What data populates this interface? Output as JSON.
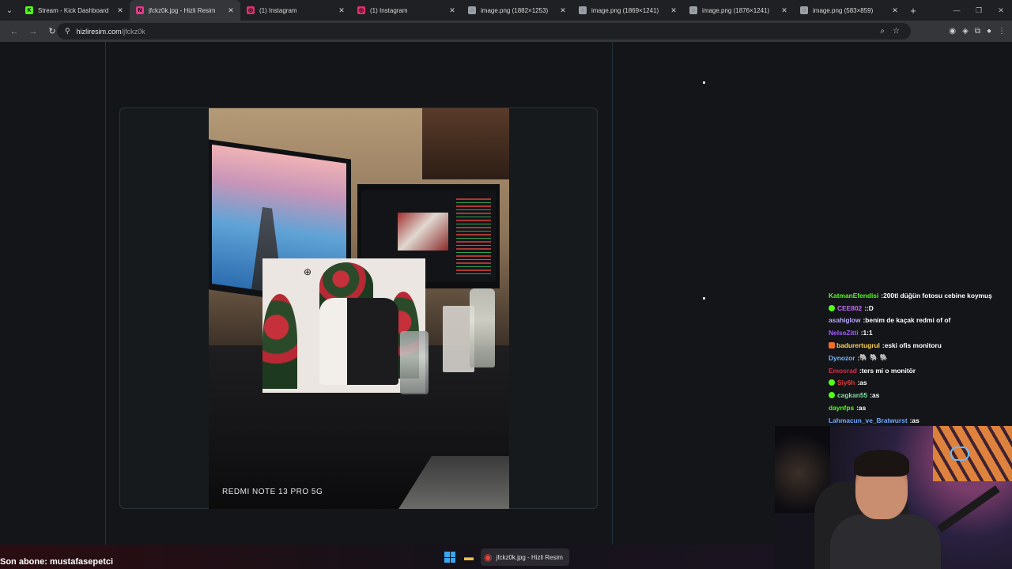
{
  "browser": {
    "tabs": [
      {
        "title": "Stream - Kick Dashboard",
        "favicon": "K",
        "favicon_color": "#53fc18",
        "active": false
      },
      {
        "title": "jfckz0k.jpg - Hizli Resim",
        "favicon": "N",
        "favicon_color": "#e23b8a",
        "active": true
      },
      {
        "title": "(1) Instagram",
        "favicon": "◎",
        "favicon_color": "#e1306c",
        "active": false
      },
      {
        "title": "(1) Instagram",
        "favicon": "◎",
        "favicon_color": "#e1306c",
        "active": false
      },
      {
        "title": "image.png (1882×1253)",
        "favicon": "◌",
        "favicon_color": "#9aa0a6",
        "active": false
      },
      {
        "title": "image.png (1869×1241)",
        "favicon": "◌",
        "favicon_color": "#9aa0a6",
        "active": false
      },
      {
        "title": "image.png (1876×1241)",
        "favicon": "◌",
        "favicon_color": "#9aa0a6",
        "active": false
      },
      {
        "title": "image.png (583×859)",
        "favicon": "◌",
        "favicon_color": "#9aa0a6",
        "active": false
      }
    ],
    "address": {
      "host": "hizliresim.com",
      "path": "/jfckz0k"
    }
  },
  "image": {
    "watermark": "REDMI NOTE 13 PRO 5G"
  },
  "chat": {
    "lines": [
      {
        "user": "KatmanEfendisi",
        "color": "#53fc18",
        "msg": "200tl düğün fotosu cebine koymuş",
        "badge": ""
      },
      {
        "user": "CEE802",
        "color": "#c36df5",
        "msg": ":D",
        "badge": "dot"
      },
      {
        "user": "asahiglow",
        "color": "#bba7ff",
        "msg": "benim de kaçak redmi of of",
        "badge": ""
      },
      {
        "user": "NelseZitti",
        "color": "#a35bff",
        "msg": "1:1",
        "badge": ""
      },
      {
        "user": "badurertugrul",
        "color": "#ffd34d",
        "msg": "eski ofis monitoru",
        "badge": "sq"
      },
      {
        "user": "Dynozor",
        "color": "#7ab8ff",
        "msg": "🐘 🐘 🐘",
        "badge": ""
      },
      {
        "user": "Emosrad",
        "color": "#d12f4b",
        "msg": "ters mi o monitör",
        "badge": ""
      },
      {
        "user": "Siy6h",
        "color": "#e03c3c",
        "msg": "as",
        "badge": "dot"
      },
      {
        "user": "cagkan55",
        "color": "#7fe0a0",
        "msg": "as",
        "badge": "dot"
      },
      {
        "user": "daynfps",
        "color": "#53fc18",
        "msg": "as",
        "badge": ""
      },
      {
        "user": "Lahmacun_ve_Bratwurst",
        "color": "#6fa8ff",
        "msg": "as",
        "badge": ""
      }
    ]
  },
  "overlay": {
    "last_sub": "Son abone: mustafasepetci"
  },
  "taskbar": {
    "app_title": "jfckz0k.jpg - Hizli Resim"
  }
}
